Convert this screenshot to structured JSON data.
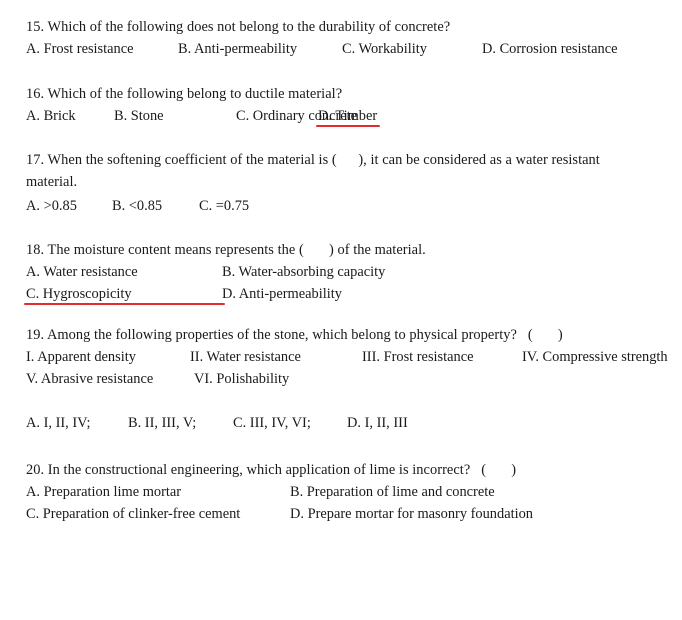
{
  "document": {
    "type": "exam-question-sheet",
    "background_color": "#ffffff",
    "text_color": "#1a1a1a",
    "annotation_color": "#e12d2d"
  },
  "questions": [
    {
      "number": "15.",
      "stem": "15. Which of the following does not belong to the durability of concrete?",
      "options": [
        {
          "label": "A. Frost resistance",
          "marked": false
        },
        {
          "label": "B. Anti-permeability",
          "marked": false
        },
        {
          "label": "C. Workability",
          "marked": false
        },
        {
          "label": "D. Corrosion resistance",
          "marked": false
        }
      ]
    },
    {
      "number": "16.",
      "stem": "16. Which of the following belong to ductile material?",
      "options": [
        {
          "label": "A. Brick",
          "marked": false
        },
        {
          "label": "B. Stone",
          "marked": false
        },
        {
          "label": "C. Ordinary concrete",
          "marked": false
        },
        {
          "label": "D. Timber",
          "marked": true
        }
      ]
    },
    {
      "number": "17.",
      "stem_part1": "17. When the softening coefficient of the material is (",
      "stem_part2": "), it can be considered as a water resistant",
      "stem_line2": "material.",
      "options": [
        {
          "label": "A. >0.85",
          "marked": false
        },
        {
          "label": "B. <0.85",
          "marked": false
        },
        {
          "label": "C. =0.75",
          "marked": false
        }
      ]
    },
    {
      "number": "18.",
      "stem_part1": "18. The moisture content means represents the (",
      "stem_part2": ") of the material.",
      "options": [
        {
          "label": "A. Water resistance",
          "marked": false
        },
        {
          "label": "B. Water-absorbing capacity",
          "marked": false
        },
        {
          "label": "C. Hygroscopicity",
          "marked": true
        },
        {
          "label": "D. Anti-permeability",
          "marked": false
        }
      ]
    },
    {
      "number": "19.",
      "stem_part1": "19. Among the following properties of the stone, which belong to physical property?",
      "stem_paren_open": "(",
      "stem_paren_close": ")",
      "items": [
        "I. Apparent density",
        "II. Water resistance",
        "III. Frost resistance",
        "IV. Compressive strength",
        "V. Abrasive resistance",
        "VI. Polishability"
      ],
      "options": [
        {
          "label": "A. I, II, IV;",
          "marked": false
        },
        {
          "label": "B. II, III, V;",
          "marked": false
        },
        {
          "label": "C. III, IV, VI;",
          "marked": false
        },
        {
          "label": "D. I, II, III",
          "marked": false
        }
      ]
    },
    {
      "number": "20.",
      "stem_part1": "20. In the constructional engineering, which application of lime is incorrect?",
      "stem_paren_open": "(",
      "stem_paren_close": ")",
      "options": [
        {
          "label": "A. Preparation lime mortar",
          "marked": false
        },
        {
          "label": "B. Preparation of lime and concrete",
          "marked": false
        },
        {
          "label": "C. Preparation of clinker-free cement",
          "marked": false
        },
        {
          "label": "D. Prepare mortar for masonry foundation",
          "marked": false
        }
      ]
    }
  ]
}
